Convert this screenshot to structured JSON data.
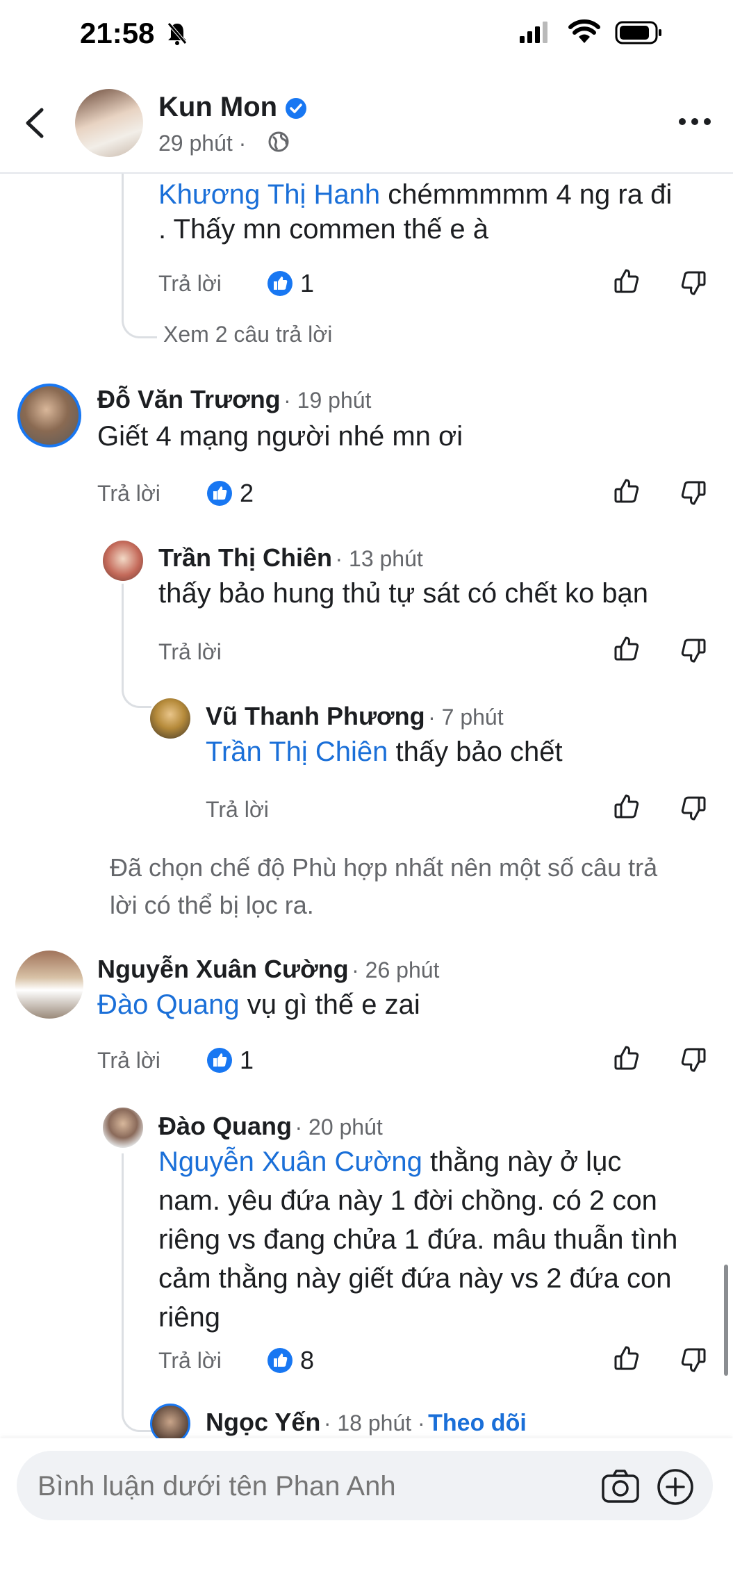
{
  "status": {
    "time": "21:58"
  },
  "header": {
    "author": "Kun Mon",
    "time": "29 phút",
    "separator": "·"
  },
  "comments": [
    {
      "mention": "Khương Thị Hanh",
      "text": " chémmmmm 4 ng ra đi",
      "text2": ". Thấy mn commen thế e à",
      "reply": "Trả lời",
      "likes": "1",
      "view_replies": "Xem 2 câu trả lời"
    },
    {
      "name": "Đỗ Văn Trương",
      "time": "· 19 phút",
      "text": "Giết 4 mạng người nhé mn ơi",
      "reply": "Trả lời",
      "likes": "2"
    },
    {
      "name": "Trần Thị Chiên",
      "time": "· 13 phút",
      "text": "thấy bảo hung thủ tự sát có chết ko bạn",
      "reply": "Trả lời"
    },
    {
      "name": "Vũ Thanh Phương",
      "time": "· 7 phút",
      "mention": "Trần Thị Chiên",
      "text": " thấy bảo chết",
      "reply": "Trả lời"
    },
    {
      "name": "Nguyễn Xuân Cường",
      "time": "· 26 phút",
      "mention": "Đào Quang",
      "text": " vụ gì thế e zai",
      "reply": "Trả lời",
      "likes": "1"
    },
    {
      "name": "Đào Quang",
      "time": "· 20 phút",
      "mention": "Nguyễn Xuân Cường",
      "text": " thằng này ở lục",
      "lines": [
        "nam. yêu đứa này 1 đời chồng. có 2 con",
        "riêng vs đang chửa 1 đứa. mâu thuẫn tình",
        "cảm thằng này giết đứa này vs 2 đứa con",
        "riêng"
      ],
      "reply": "Trả lời",
      "likes": "8"
    },
    {
      "name": "Ngọc Yến",
      "time": "· 18 phút ·",
      "follow": "Theo dõi"
    }
  ],
  "filter_notice": {
    "line1": "Đã chọn chế độ Phù hợp nhất nên một số câu trả",
    "line2": "lời có thể bị lọc ra."
  },
  "composer": {
    "placeholder": "Bình luận dưới tên Phan Anh"
  },
  "colors": {
    "link": "#1a6fd8",
    "like_blue": "#1877f2",
    "muted": "#65676b"
  }
}
